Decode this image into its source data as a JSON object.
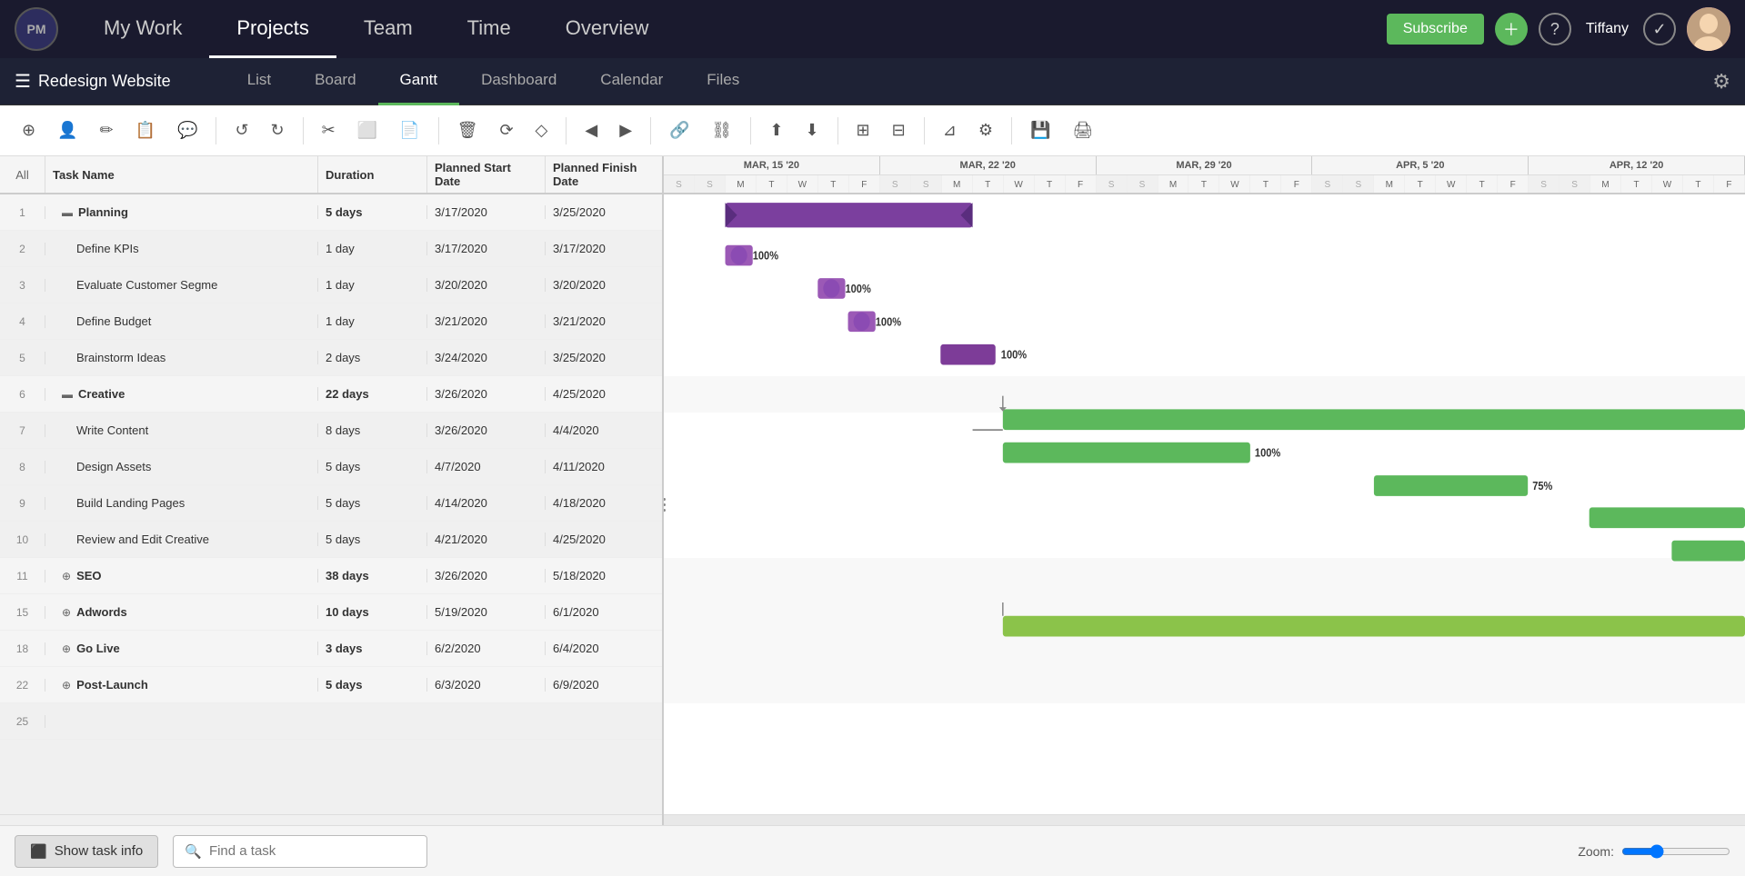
{
  "nav": {
    "logo_text": "PM",
    "items": [
      {
        "label": "My Work",
        "active": false
      },
      {
        "label": "Projects",
        "active": true
      },
      {
        "label": "Team",
        "active": false
      },
      {
        "label": "Time",
        "active": false
      },
      {
        "label": "Overview",
        "active": false
      }
    ],
    "subscribe_label": "Subscribe",
    "user_name": "Tiffany"
  },
  "sub_nav": {
    "project_name": "Redesign Website",
    "tabs": [
      {
        "label": "List",
        "active": false
      },
      {
        "label": "Board",
        "active": false
      },
      {
        "label": "Gantt",
        "active": true
      },
      {
        "label": "Dashboard",
        "active": false
      },
      {
        "label": "Calendar",
        "active": false
      },
      {
        "label": "Files",
        "active": false
      }
    ]
  },
  "toolbar": {
    "buttons": [
      {
        "icon": "+",
        "name": "add-task-btn"
      },
      {
        "icon": "👤",
        "name": "add-person-btn"
      },
      {
        "icon": "✏️",
        "name": "edit-btn"
      },
      {
        "icon": "📋",
        "name": "copy-btn"
      },
      {
        "icon": "💬",
        "name": "comment-btn"
      },
      {
        "sep": true
      },
      {
        "icon": "↩",
        "name": "undo-btn"
      },
      {
        "icon": "↪",
        "name": "redo-btn"
      },
      {
        "sep": true
      },
      {
        "icon": "✂",
        "name": "cut-btn"
      },
      {
        "icon": "⬜",
        "name": "wrap-btn"
      },
      {
        "icon": "📄",
        "name": "paste-btn"
      },
      {
        "sep": true
      },
      {
        "icon": "🗑",
        "name": "delete-btn"
      },
      {
        "icon": "🔗",
        "name": "link-type-btn"
      },
      {
        "icon": "◇",
        "name": "milestone-btn"
      },
      {
        "sep": true
      },
      {
        "icon": "◀",
        "name": "scroll-left-btn"
      },
      {
        "icon": "▶",
        "name": "scroll-right-btn"
      },
      {
        "sep": true
      },
      {
        "icon": "🔗",
        "name": "link-btn"
      },
      {
        "icon": "⛓",
        "name": "unlink-btn"
      },
      {
        "sep": true
      },
      {
        "icon": "⬆",
        "name": "export-btn"
      },
      {
        "icon": "⬇",
        "name": "share-btn"
      },
      {
        "sep": true
      },
      {
        "icon": "⊞",
        "name": "columns-btn"
      },
      {
        "icon": "⊟",
        "name": "rows-btn"
      },
      {
        "sep": true
      },
      {
        "icon": "⊿",
        "name": "filter-btn"
      },
      {
        "icon": "⚙",
        "name": "settings-btn"
      },
      {
        "sep": true
      },
      {
        "icon": "💾",
        "name": "save-btn"
      },
      {
        "icon": "🖨",
        "name": "print-btn"
      }
    ]
  },
  "grid": {
    "columns": [
      "All",
      "Task Name",
      "Duration",
      "Planned Start Date",
      "Planned Finish Date"
    ],
    "rows": [
      {
        "num": "1",
        "name": "Planning",
        "group": true,
        "color": "purple",
        "expanded": true,
        "duration": "5 days",
        "start": "3/17/2020",
        "finish": "3/25/2020"
      },
      {
        "num": "2",
        "name": "Define KPIs",
        "group": false,
        "color": "purple",
        "indent": true,
        "duration": "1 day",
        "start": "3/17/2020",
        "finish": "3/17/2020"
      },
      {
        "num": "3",
        "name": "Evaluate Customer Segme",
        "group": false,
        "color": "purple",
        "indent": true,
        "duration": "1 day",
        "start": "3/20/2020",
        "finish": "3/20/2020"
      },
      {
        "num": "4",
        "name": "Define Budget",
        "group": false,
        "color": "purple",
        "indent": true,
        "duration": "1 day",
        "start": "3/21/2020",
        "finish": "3/21/2020"
      },
      {
        "num": "5",
        "name": "Brainstorm Ideas",
        "group": false,
        "color": "purple",
        "indent": true,
        "duration": "2 days",
        "start": "3/24/2020",
        "finish": "3/25/2020"
      },
      {
        "num": "6",
        "name": "Creative",
        "group": true,
        "color": "green",
        "expanded": true,
        "duration": "22 days",
        "start": "3/26/2020",
        "finish": "4/25/2020"
      },
      {
        "num": "7",
        "name": "Write Content",
        "group": false,
        "color": "green",
        "indent": true,
        "duration": "8 days",
        "start": "3/26/2020",
        "finish": "4/4/2020"
      },
      {
        "num": "8",
        "name": "Design Assets",
        "group": false,
        "color": "green",
        "indent": true,
        "duration": "5 days",
        "start": "4/7/2020",
        "finish": "4/11/2020"
      },
      {
        "num": "9",
        "name": "Build Landing Pages",
        "group": false,
        "color": "green",
        "indent": true,
        "duration": "5 days",
        "start": "4/14/2020",
        "finish": "4/18/2020"
      },
      {
        "num": "10",
        "name": "Review and Edit Creative",
        "group": false,
        "color": "green",
        "indent": true,
        "duration": "5 days",
        "start": "4/21/2020",
        "finish": "4/25/2020"
      },
      {
        "num": "11",
        "name": "SEO",
        "group": true,
        "color": "olive",
        "expanded": false,
        "duration": "38 days",
        "start": "3/26/2020",
        "finish": "5/18/2020"
      },
      {
        "num": "15",
        "name": "Adwords",
        "group": true,
        "color": "blue",
        "expanded": false,
        "duration": "10 days",
        "start": "5/19/2020",
        "finish": "6/1/2020"
      },
      {
        "num": "18",
        "name": "Go Live",
        "group": true,
        "color": "olive",
        "expanded": false,
        "duration": "3 days",
        "start": "6/2/2020",
        "finish": "6/4/2020"
      },
      {
        "num": "22",
        "name": "Post-Launch",
        "group": true,
        "color": "orange",
        "expanded": false,
        "duration": "5 days",
        "start": "6/3/2020",
        "finish": "6/9/2020"
      },
      {
        "num": "25",
        "name": "",
        "group": false,
        "color": "",
        "duration": "",
        "start": "",
        "finish": ""
      }
    ]
  },
  "gantt": {
    "date_groups": [
      {
        "label": "MAR, 15 '20",
        "span": 7
      },
      {
        "label": "MAR, 22 '20",
        "span": 7
      },
      {
        "label": "MAR, 29 '20",
        "span": 7
      },
      {
        "label": "APR, 5 '20",
        "span": 7
      },
      {
        "label": "APR, 12 '20",
        "span": 7
      }
    ],
    "days": [
      "S",
      "S",
      "M",
      "T",
      "W",
      "T",
      "F",
      "S",
      "S",
      "M",
      "T",
      "W",
      "T",
      "F",
      "S",
      "S",
      "M",
      "T",
      "W",
      "T",
      "F",
      "S",
      "S",
      "M",
      "T",
      "W",
      "T",
      "F",
      "S",
      "S",
      "M",
      "T",
      "W",
      "T",
      "F"
    ]
  },
  "bottom_bar": {
    "show_task_info_label": "Show task info",
    "find_task_placeholder": "Find a task",
    "zoom_label": "Zoom:"
  }
}
